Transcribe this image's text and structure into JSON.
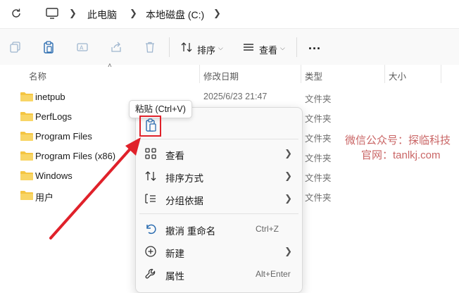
{
  "address": {
    "refresh_icon": "refresh-icon",
    "computer_icon": "monitor-icon",
    "breadcrumb": [
      "此电脑",
      "本地磁盘 (C:)"
    ]
  },
  "toolbar": {
    "icons": [
      "copy-icon",
      "paste-icon",
      "rename-icon",
      "share-icon",
      "delete-icon"
    ],
    "sort_label": "排序",
    "view_label": "查看",
    "more_label": "..."
  },
  "columns": {
    "name": "名称",
    "date": "修改日期",
    "type": "类型",
    "size": "大小"
  },
  "files": [
    {
      "name": "inetpub",
      "date": "2025/6/23 21:47",
      "type": "文件夹"
    },
    {
      "name": "PerfLogs",
      "date": "",
      "type": "文件夹"
    },
    {
      "name": "Program Files",
      "date": "",
      "type": "文件夹"
    },
    {
      "name": "Program Files (x86)",
      "date": "",
      "type": "文件夹"
    },
    {
      "name": "Windows",
      "date": "",
      "type": "文件夹"
    },
    {
      "name": "用户",
      "date": "",
      "type": "文件夹"
    }
  ],
  "tooltip": "粘贴 (Ctrl+V)",
  "context_menu": {
    "items": [
      {
        "label": "查看",
        "icon": "view-grid-icon",
        "submenu": true
      },
      {
        "label": "排序方式",
        "icon": "sort-arrows-icon",
        "submenu": true
      },
      {
        "label": "分组依据",
        "icon": "group-list-icon",
        "submenu": true
      },
      {
        "label": "撤消 重命名",
        "icon": "undo-icon",
        "shortcut": "Ctrl+Z"
      },
      {
        "label": "新建",
        "icon": "new-plus-icon",
        "submenu": true
      },
      {
        "label": "属性",
        "icon": "wrench-icon",
        "shortcut": "Alt+Enter"
      }
    ]
  },
  "watermark": {
    "line1": "微信公众号：探临科技",
    "line2": "官网：tanlkj.com"
  },
  "colors": {
    "folder": "#f4c542",
    "highlight": "#e0212a",
    "arrow": "#e0212a",
    "icon_blue": "#2b6cb0"
  }
}
